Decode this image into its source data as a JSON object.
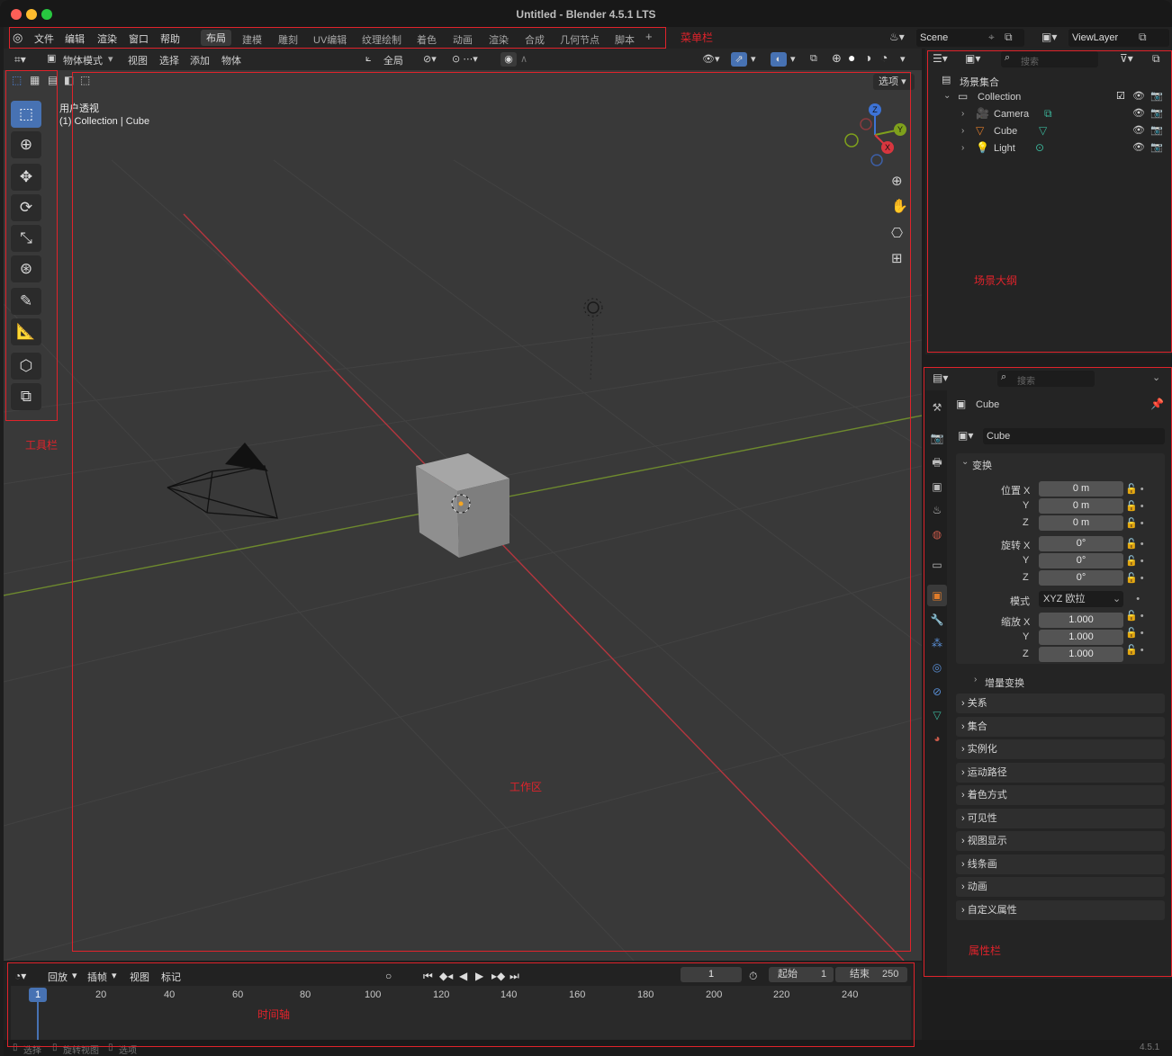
{
  "window": {
    "title": "Untitled - Blender 4.5.1 LTS"
  },
  "menubar": {
    "menus": [
      "文件",
      "编辑",
      "渲染",
      "窗口",
      "帮助"
    ],
    "workspaces": [
      "布局",
      "建模",
      "雕刻",
      "UV编辑",
      "纹理绘制",
      "着色",
      "动画",
      "渲染",
      "合成",
      "几何节点",
      "脚本"
    ],
    "add_tab": "+",
    "scene": "Scene",
    "view_layer": "ViewLayer"
  },
  "viewport_header": {
    "mode": "物体模式",
    "menus": [
      "视图",
      "选择",
      "添加",
      "物体"
    ],
    "transform_orientation": "全局",
    "options": "选项"
  },
  "viewport": {
    "view_name": "用户透视",
    "collection_info": "(1) Collection | Cube",
    "axes": [
      "Z",
      "Y",
      "X"
    ]
  },
  "outliner": {
    "search_placeholder": "搜索",
    "scene_collection": "场景集合",
    "collection": "Collection",
    "objects": [
      "Camera",
      "Cube",
      "Light"
    ]
  },
  "properties": {
    "search_placeholder": "搜索",
    "object_name": "Cube",
    "data_name": "Cube",
    "transform_title": "变换",
    "location_label": "位置 X",
    "rotation_label": "旋转 X",
    "scale_label": "缩放 X",
    "y_label": "Y",
    "z_label": "Z",
    "location": [
      "0 m",
      "0 m",
      "0 m"
    ],
    "rotation": [
      "0°",
      "0°",
      "0°"
    ],
    "mode_label": "模式",
    "mode_value": "XYZ 欧拉",
    "scale": [
      "1.000",
      "1.000",
      "1.000"
    ],
    "delta_transform": "增量变换",
    "panels": [
      "关系",
      "集合",
      "实例化",
      "运动路径",
      "着色方式",
      "可见性",
      "视图显示",
      "线条画",
      "动画",
      "自定义属性"
    ]
  },
  "timeline": {
    "menus": [
      "回放",
      "插帧",
      "视图",
      "标记"
    ],
    "current_frame": "1",
    "start_label": "起始",
    "start_value": "1",
    "end_label": "结束",
    "end_value": "250",
    "ticks": [
      "1",
      "20",
      "40",
      "60",
      "80",
      "100",
      "120",
      "140",
      "160",
      "180",
      "200",
      "220",
      "240"
    ]
  },
  "status": {
    "items": [
      "选择",
      "旋转视图",
      "选项"
    ],
    "version": "4.5.1"
  },
  "annotations": {
    "menubar": "菜单栏",
    "outliner": "场景大纲",
    "toolbar": "工具栏",
    "workspace": "工作区",
    "properties": "属性栏",
    "timeline": "时间轴"
  },
  "colors": {
    "accent": "#4772b3",
    "annotation_red": "#e0232b",
    "x_axis": "#d8363f",
    "y_axis": "#7fa11c",
    "z_axis": "#3d73d6"
  }
}
